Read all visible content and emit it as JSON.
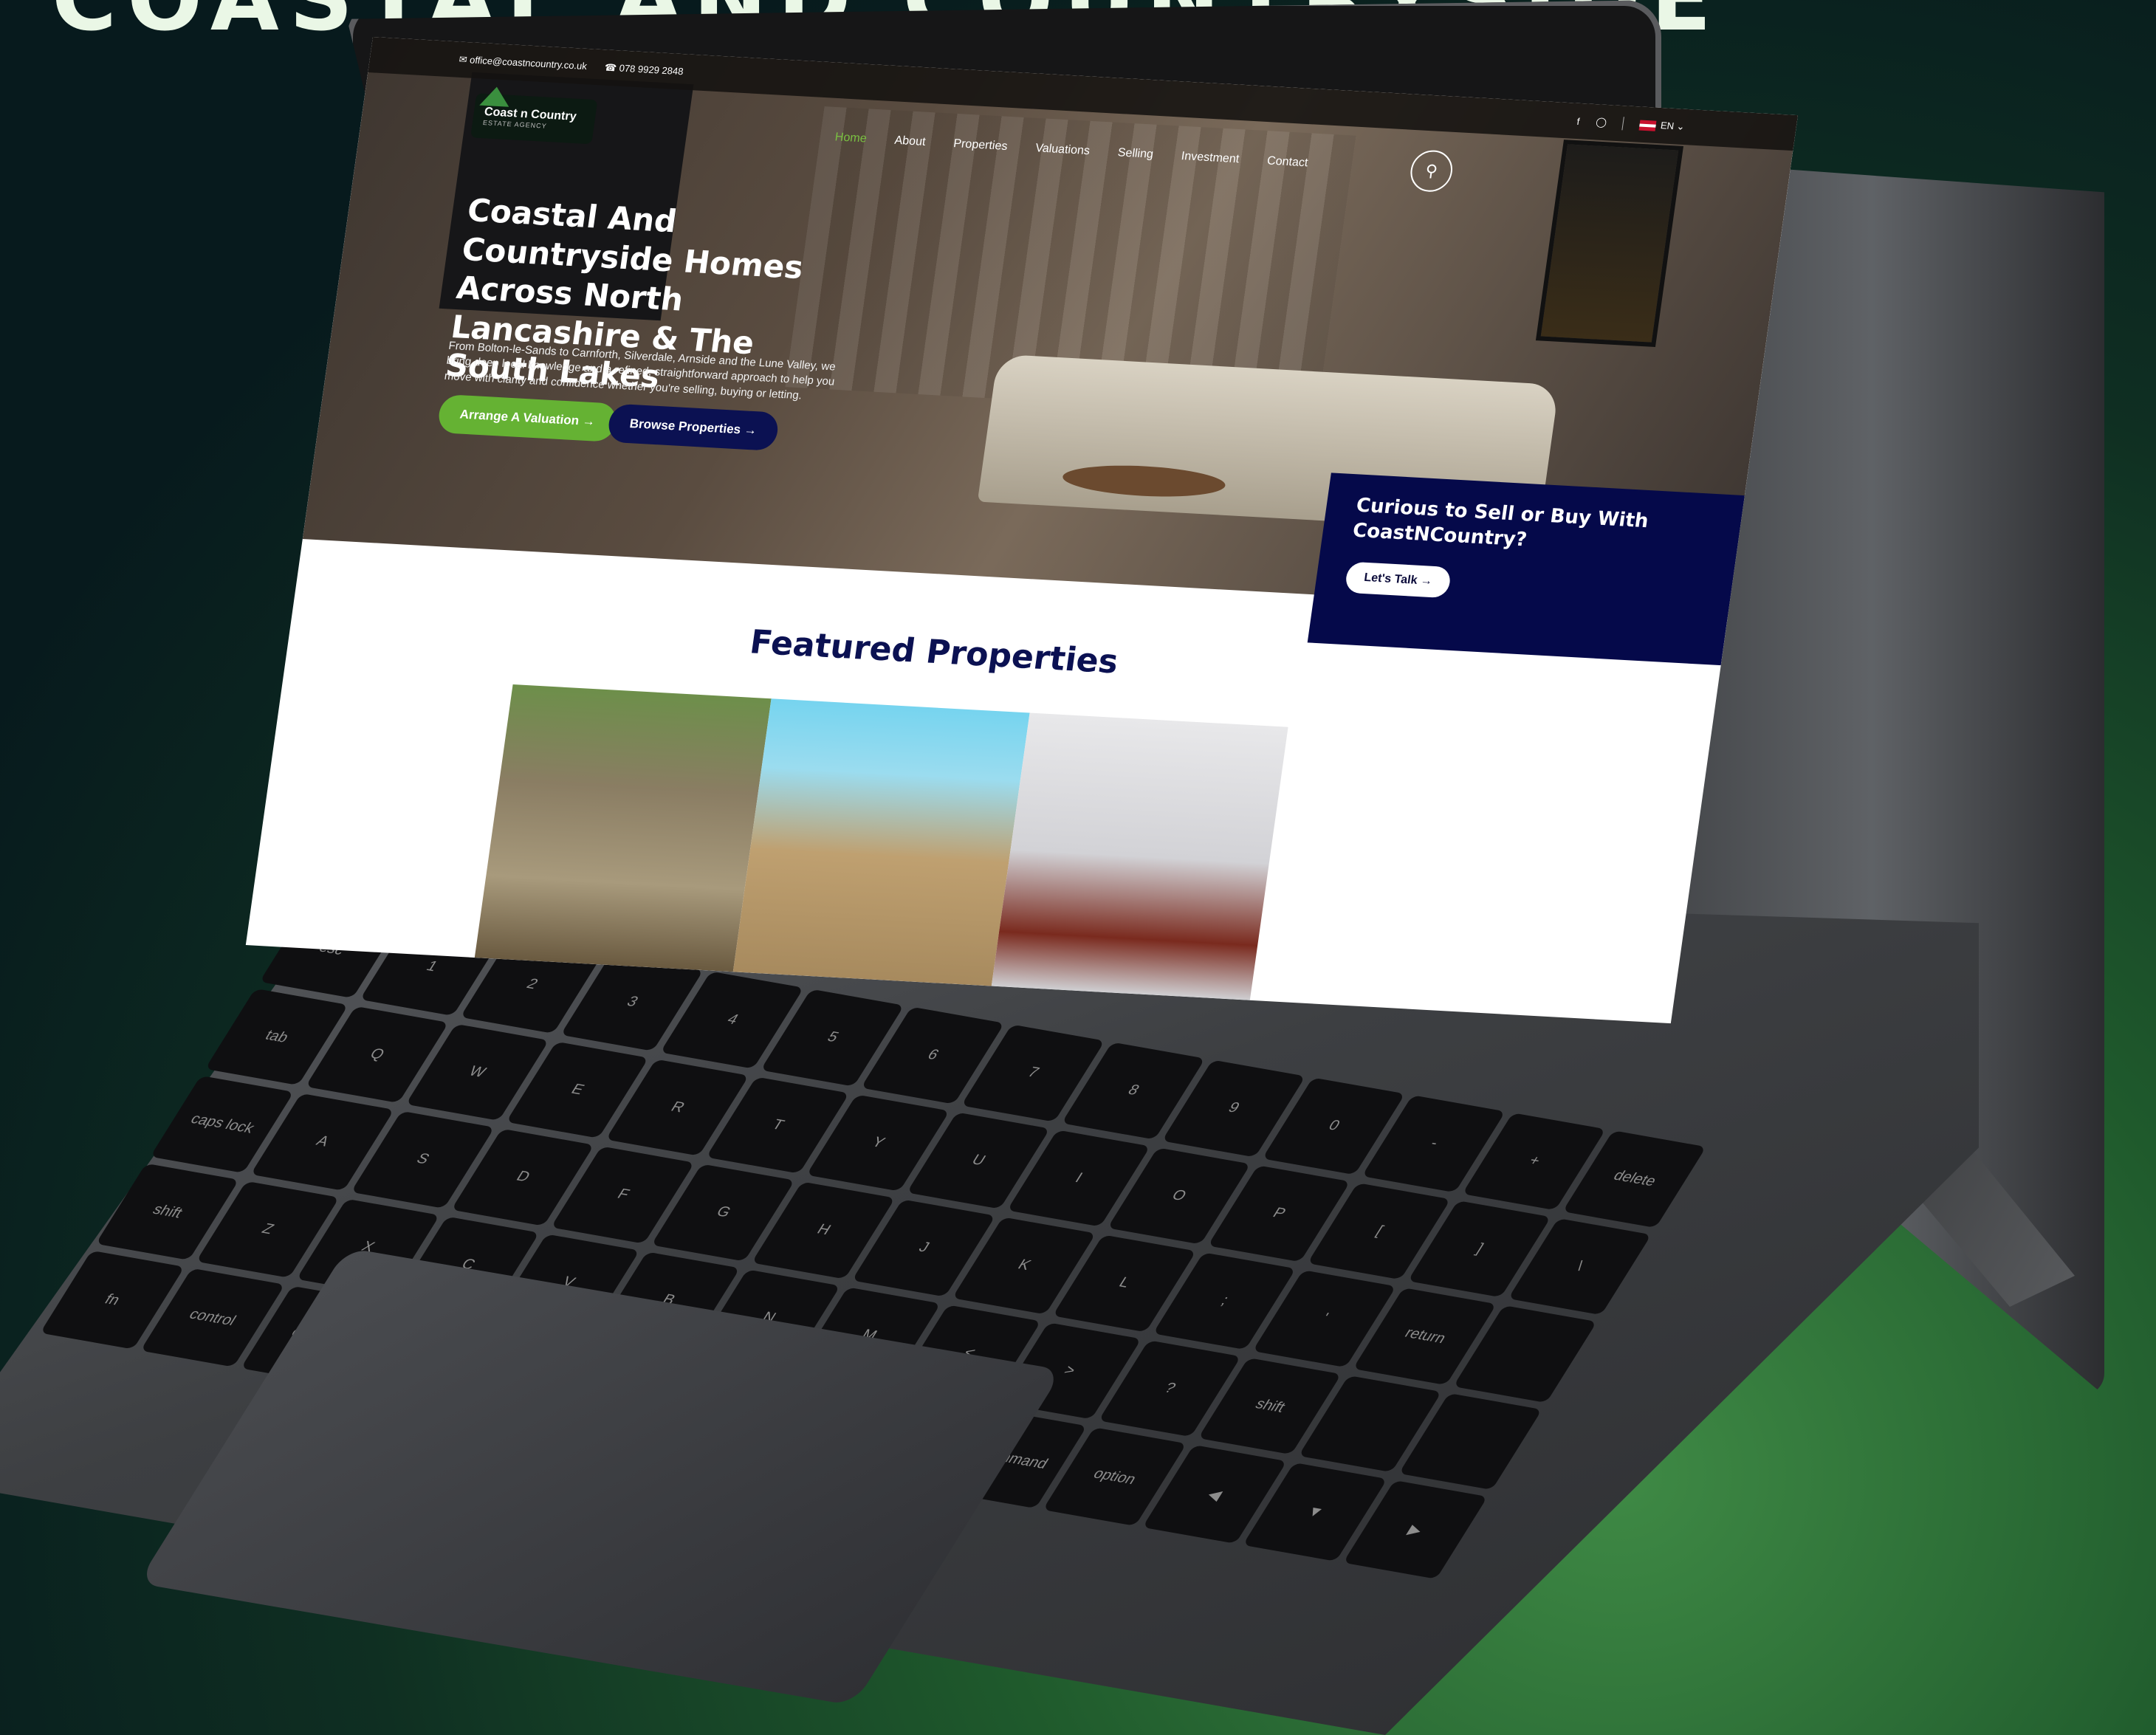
{
  "page": {
    "heading": "COASTAL AND COUNTRYSIDE"
  },
  "topbar": {
    "email": "office@coastncountry.co.uk",
    "phone": "078 9929 2848",
    "language": "EN",
    "social": [
      "facebook-icon",
      "instagram-icon"
    ]
  },
  "logo": {
    "name": "Coast n Country",
    "tagline": "ESTATE AGENCY"
  },
  "nav": {
    "items": [
      "Home",
      "About",
      "Properties",
      "Valuations",
      "Selling",
      "Investment",
      "Contact"
    ],
    "active": "Home"
  },
  "hero": {
    "title": "Coastal And Countryside Homes Across North Lancashire & The South Lakes",
    "subtitle": "From Bolton-le-Sands to Carnforth, Silverdale, Arnside and the Lune Valley, we bring deep local knowledge and a refined, straightforward approach to help you move with clarity and confidence whether you're selling, buying or letting.",
    "primary_button": "Arrange A Valuation →",
    "secondary_button": "Browse Properties →"
  },
  "cta": {
    "title": "Curious to Sell or Buy With CoastNCountry?",
    "button": "Let's Talk →"
  },
  "featured": {
    "title": "Featured Properties"
  },
  "keyboard": {
    "keys": [
      "esc",
      "1",
      "2",
      "3",
      "4",
      "5",
      "6",
      "7",
      "8",
      "9",
      "0",
      "-",
      "+",
      "delete",
      "tab",
      "Q",
      "W",
      "E",
      "R",
      "T",
      "Y",
      "U",
      "I",
      "O",
      "P",
      "[",
      "]",
      "\\",
      "caps lock",
      "A",
      "S",
      "D",
      "F",
      "G",
      "H",
      "J",
      "K",
      "L",
      ";",
      "'",
      "return",
      "",
      "shift",
      "Z",
      "X",
      "C",
      "V",
      "B",
      "N",
      "M",
      "<",
      ">",
      "?",
      "shift",
      "",
      "",
      "fn",
      "control",
      "option",
      "command",
      "",
      "",
      "",
      "",
      "",
      "command",
      "option",
      "◀",
      "▼",
      "▶"
    ]
  },
  "colors": {
    "accent_green": "#65b233",
    "navy": "#0b1152",
    "cta_bg": "#05094a"
  }
}
